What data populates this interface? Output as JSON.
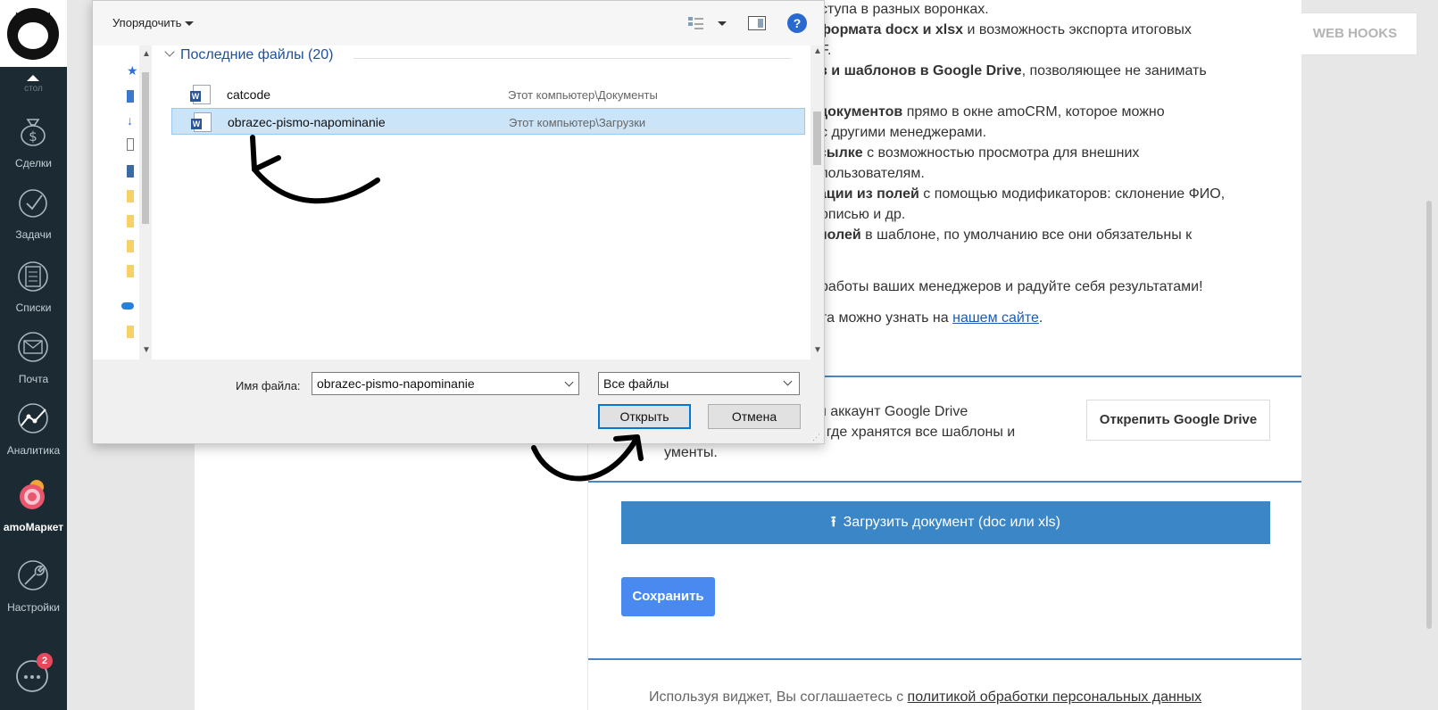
{
  "sidebar": {
    "cut_label": "стол",
    "items": [
      {
        "label": "Сделки"
      },
      {
        "label": "Задачи"
      },
      {
        "label": "Списки"
      },
      {
        "label": "Почта"
      },
      {
        "label": "Аналитика"
      },
      {
        "label": "amoМаркет"
      },
      {
        "label": "Настройки"
      }
    ],
    "chat_badge": "2"
  },
  "page": {
    "webhooks_label": "WEB HOOKS"
  },
  "widget": {
    "desc_lines": [
      {
        "plain": "ступа в разных воронках.",
        "bold": "",
        "rest": ""
      },
      {
        "plain": "",
        "bold": "формата docx и xlsx",
        "rest": " и возможность экспорта итоговых"
      },
      {
        "plain": "F.",
        "bold": "",
        "rest": ""
      },
      {
        "plain": "",
        "bold": "в и шаблонов в Google Drive",
        "rest": ", позволяющее не занимать"
      },
      {
        "plain": ".",
        "bold": "",
        "rest": ""
      },
      {
        "plain": "",
        "bold": "документов",
        "rest": " прямо в окне amoCRM, которое можно"
      },
      {
        "plain": "с другими менеджерами.",
        "bold": "",
        "rest": ""
      },
      {
        "plain": "",
        "bold": "сылке",
        "rest": " с возможностью просмотра для внешних"
      },
      {
        "plain": "пользователям.",
        "bold": "",
        "rest": ""
      },
      {
        "plain": "",
        "bold": "ации из полей",
        "rest": " с помощью модификаторов: склонение ФИО,"
      },
      {
        "plain": "описью и др.",
        "bold": "",
        "rest": ""
      },
      {
        "plain": "",
        "bold": "полей",
        "rest": " в шаблоне, по умолчанию все они обязательны к"
      },
      {
        "plain": "работы ваших менеджеров и радуйте себя результатами!",
        "bold": "",
        "rest": ""
      }
    ],
    "site_line_prefix": "та можно узнать на ",
    "site_link": "нашем сайте",
    "site_line_suffix": ".",
    "gd_line1": "н аккаунт Google Drive",
    "gd_line2": ", где хранятся все шаблоны и",
    "gd_line3": "ументы.",
    "unpin_label": "Открепить Google Drive",
    "upload_label": "Загрузить документ (doc или xls)",
    "save_label": "Сохранить",
    "agree_prefix": "Используя виджет, Вы соглашаетесь с ",
    "agree_link": "политикой обработки персональных данных"
  },
  "dialog": {
    "organize_label": "Упорядочить",
    "help_label": "?",
    "group_header": "Последние файлы (20)",
    "files": [
      {
        "name": "catcode",
        "location": "Этот компьютер\\Документы"
      },
      {
        "name": "obrazec-pismo-napominanie",
        "location": "Этот компьютер\\Загрузки"
      }
    ],
    "filename_label": "Имя файла:",
    "filename_value": "obrazec-pismo-napominanie",
    "filetype_value": "Все файлы",
    "open_label": "Открыть",
    "cancel_label": "Отмена"
  },
  "colors": {
    "sidebar_bg": "#1b2a33",
    "accent_blue": "#3b86c6",
    "save_blue": "#4a8af0",
    "selection": "#cce4f7"
  }
}
